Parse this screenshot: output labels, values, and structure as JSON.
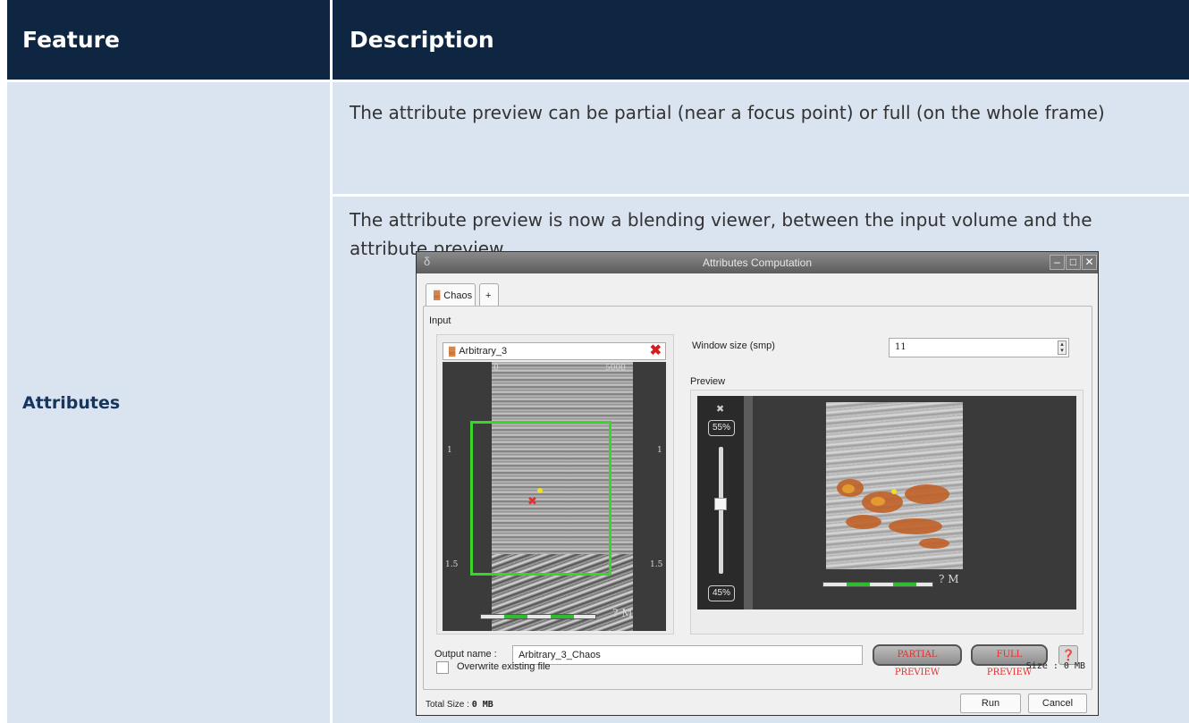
{
  "table": {
    "header_feature": "Feature",
    "header_description": "Description",
    "feature": "Attributes",
    "desc1": "The attribute preview can be partial (near a focus point) or full (on the whole frame)",
    "desc2": "The attribute preview is now a blending viewer, between the input volume and the attribute preview"
  },
  "dialog": {
    "title": "Attributes Computation",
    "tab_label": "Chaos",
    "add_tab": "+",
    "input_label": "Input",
    "input_value": "Arbitrary_3",
    "window_size_label": "Window size (smp)",
    "window_size_value": "11",
    "preview_label": "Preview",
    "axis_left_top": "0",
    "axis_right_top": "5000",
    "axis_row1": "1",
    "axis_row2": "1.5",
    "scale_unit": "? M",
    "slider_top": "55%",
    "slider_bottom": "45%",
    "output_name_label": "Output name :",
    "output_name_value": "Arbitrary_3_Chaos",
    "partial_preview": "PARTIAL PREVIEW",
    "full_preview": "FULL PREVIEW",
    "overwrite_label": "Overwrite existing file",
    "size_label": "Size : 0 MB",
    "total_size_label": "Total Size :",
    "total_size_value": "0 MB",
    "run": "Run",
    "cancel": "Cancel"
  },
  "colors": {
    "header_bg": "#0f2643",
    "cell_bg": "#dae3f0",
    "feature_text": "#17365d",
    "highlight_green": "#39d62a",
    "preview_button_text": "#e03030"
  },
  "icons": [
    "app-logo-icon",
    "seismic-volume-icon",
    "remove-icon",
    "minimize-icon",
    "maximize-icon",
    "close-icon",
    "help-icon"
  ]
}
